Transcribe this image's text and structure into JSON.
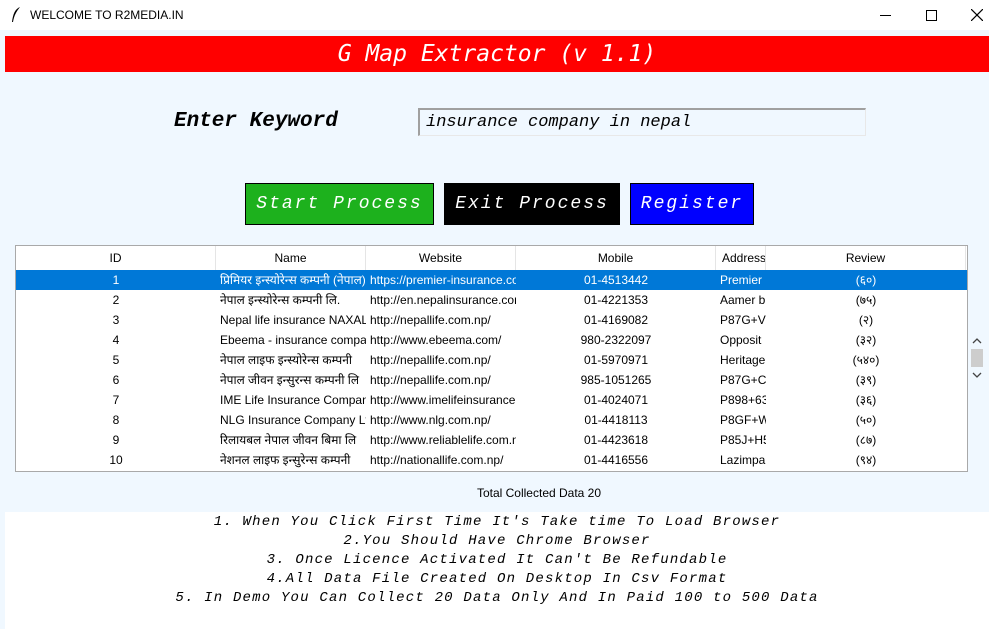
{
  "window": {
    "title": "WELCOME TO R2MEDIA.IN"
  },
  "banner": {
    "text": "G Map Extractor (v 1.1)"
  },
  "keyword": {
    "label": "Enter Keyword",
    "value": "insurance company in nepal"
  },
  "buttons": {
    "start": "Start Process",
    "exit": "Exit Process",
    "register": "Register"
  },
  "table": {
    "columns": [
      "ID",
      "Name",
      "Website",
      "Mobile",
      "Address",
      "Review"
    ],
    "rows": [
      [
        "1",
        "प्रिमियर इन्स्योरेन्स कम्पनी (नेपाल)",
        "https://premier-insurance.com.np/",
        "01-4513442",
        "Premier",
        "(६०)"
      ],
      [
        "2",
        "नेपाल इन्स्योरेन्स कम्पनी लि.",
        "http://en.nepalinsurance.com.np/",
        "01-4221353",
        "Aamer b",
        "(७५)"
      ],
      [
        "3",
        "Nepal life insurance NAXAL",
        "http://nepallife.com.np/",
        "01-4169082",
        "P87G+V",
        "(२)"
      ],
      [
        "4",
        "Ebeema - insurance company",
        "http://www.ebeema.com/",
        "980-2322097",
        "Opposit",
        "(३२)"
      ],
      [
        "5",
        "नेपाल लाइफ इन्स्योरेन्स कम्पनी",
        "http://nepallife.com.np/",
        "01-5970971",
        "Heritage",
        "(५४०)"
      ],
      [
        "6",
        "नेपाल जीवन इन्सुरन्स कम्पनी लि",
        "http://nepallife.com.np/",
        "985-1051265",
        "P87G+C",
        "(३९)"
      ],
      [
        "7",
        "IME Life Insurance Company",
        "http://www.imelifeinsurance.com/",
        "01-4024071",
        "P898+63",
        "(३६)"
      ],
      [
        "8",
        "NLG Insurance Company Ltd",
        "http://www.nlg.com.np/",
        "01-4418113",
        "P8GF+W",
        "(५०)"
      ],
      [
        "9",
        "रिलायबल नेपाल जीवन बिमा लि",
        "http://www.reliablelife.com.np/",
        "01-4423618",
        "P85J+H5",
        "(८७)"
      ],
      [
        "10",
        "नेशनल लाइफ इन्सुरेन्स कम्पनी",
        "http://nationallife.com.np/",
        "01-4416556",
        "Lazimpa",
        "(९४)"
      ]
    ]
  },
  "total": "Total Collected Data 20",
  "notes": [
    "1. When You Click First Time It's Take time To Load Browser",
    "2.You Should Have Chrome Browser",
    "3. Once Licence Activated It Can't Be Refundable",
    "4.All Data File Created On Desktop In Csv Format",
    "5. In Demo You Can Collect 20 Data Only And In Paid 100 to 500 Data"
  ],
  "icons": {
    "app": "feather-icon",
    "minimize": "minimize-icon",
    "maximize": "maximize-icon",
    "close": "close-icon"
  }
}
